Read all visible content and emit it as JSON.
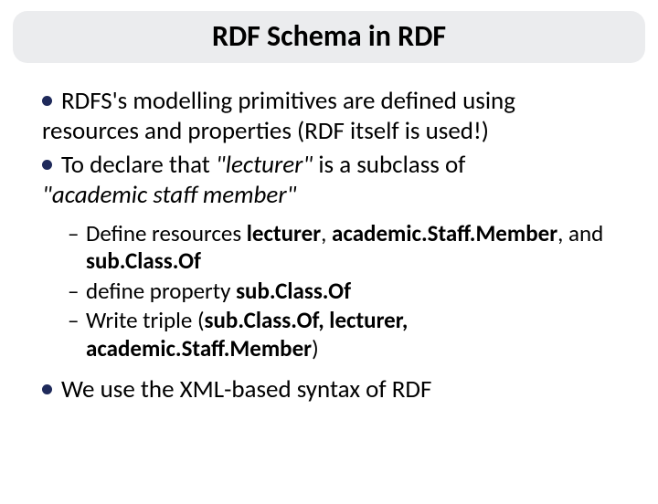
{
  "title": "RDF Schema in RDF",
  "bullets": {
    "b1_a": "RDFS's modelling primitives are defined using ",
    "b1_b": "resources and properties (RDF itself is used!)",
    "b2_a": "To declare that ",
    "b2_b": "\"lecturer\"",
    "b2_c": " is a subclass of ",
    "b2_d": "\"academic staff member\"",
    "b3": "We use the XML-based syntax of RDF"
  },
  "sub": {
    "s1_a": "Define resources ",
    "s1_b": "lecturer",
    "s1_c": ", ",
    "s1_d": "academic.Staff.Member",
    "s1_e": ", and ",
    "s1_f": "sub.Class.Of",
    "s2_a": "define property ",
    "s2_b": "sub.Class.Of",
    "s3_a": "Write triple (",
    "s3_b": "sub.Class.Of, lecturer, academic.Staff.Member",
    "s3_c": ")"
  }
}
